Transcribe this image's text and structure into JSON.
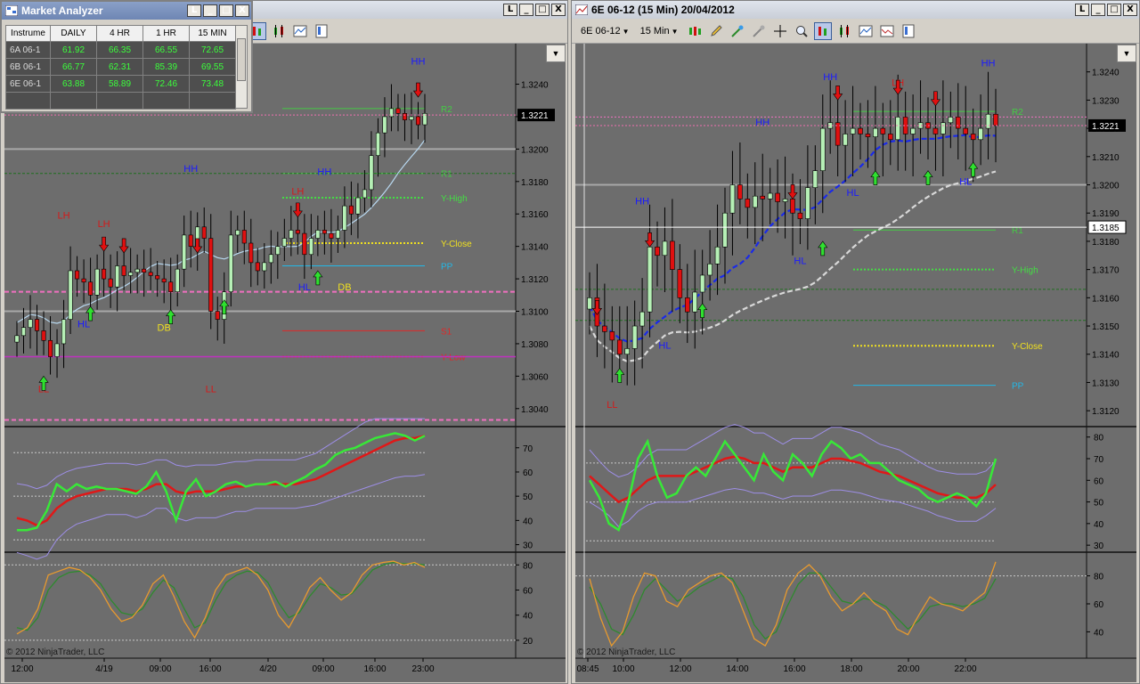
{
  "left_window": {
    "titlebar_buttons": [
      "L",
      "_",
      "□",
      "X"
    ]
  },
  "right_window": {
    "title": "6E 06-12 (15 Min)  20/04/2012",
    "titlebar_buttons": [
      "L",
      "_",
      "□",
      "X"
    ],
    "instrument": "6E 06-12",
    "interval": "15 Min"
  },
  "market_analyzer": {
    "title": "Market Analyzer",
    "columns": [
      "Instrume",
      "DAILY",
      "4 HR",
      "1 HR",
      "15 MIN"
    ],
    "rows": [
      [
        "6A 06-1",
        "61.92",
        "66.35",
        "66.55",
        "72.65"
      ],
      [
        "6B 06-1",
        "66.77",
        "62.31",
        "85.39",
        "69.55"
      ],
      [
        "6E 06-1",
        "63.88",
        "58.89",
        "72.46",
        "73.48"
      ]
    ]
  },
  "copyright": "© 2012 NinjaTrader, LLC",
  "colors": {
    "chart_bg": "#6d6d6d",
    "bull": "#b6f0b6",
    "bear": "#e01010",
    "rsi_green": "#38e838",
    "rsi_red": "#e01818",
    "stoch_orange": "#e89a2e",
    "stoch_green": "#2e8a2e",
    "band": "#9d8ee6",
    "blue_label": "#1a1aff",
    "red_label": "#d41a1a",
    "yellow_label": "#f0e020"
  },
  "chart_data": [
    {
      "id": "left",
      "type": "candlestick",
      "x_labels": [
        "12:00",
        "4/19",
        "09:00",
        "16:00",
        "4/20",
        "09:00",
        "16:00",
        "23:00"
      ],
      "price_ticks": [
        "1.3240",
        "1.3220",
        "1.3200",
        "1.3180",
        "1.3160",
        "1.3140",
        "1.3120",
        "1.3100",
        "1.3080",
        "1.3060",
        "1.3040"
      ],
      "ylim": [
        1.303,
        1.3265
      ],
      "current_price": "1.3221",
      "close": [
        1.3085,
        1.309,
        1.3095,
        1.3088,
        1.3082,
        1.3072,
        1.308,
        1.3095,
        1.3125,
        1.312,
        1.3118,
        1.311,
        1.3126,
        1.312,
        1.3115,
        1.3128,
        1.3122,
        1.3124,
        1.3126,
        1.3124,
        1.3122,
        1.312,
        1.3118,
        1.3112,
        1.3126,
        1.3147,
        1.314,
        1.3152,
        1.3145,
        1.31,
        1.3095,
        1.3112,
        1.3147,
        1.315,
        1.3142,
        1.313,
        1.3125,
        1.313,
        1.3135,
        1.314,
        1.3145,
        1.315,
        1.3148,
        1.3135,
        1.3145,
        1.315,
        1.3148,
        1.3145,
        1.315,
        1.3165,
        1.316,
        1.317,
        1.3175,
        1.3196,
        1.321,
        1.322,
        1.3225,
        1.3222,
        1.3218,
        1.322,
        1.3215,
        1.3222
      ],
      "levels": [
        {
          "label": "R2",
          "value": 1.3225,
          "color": "#44cc44"
        },
        {
          "label": "R1",
          "value": 1.3185,
          "color": "#44cc44"
        },
        {
          "label": "Y-High",
          "value": 1.317,
          "color": "#44dd44"
        },
        {
          "label": "Y-Close",
          "value": 1.3142,
          "color": "#f0e020"
        },
        {
          "label": "PP",
          "value": 1.3128,
          "color": "#22b8e8"
        },
        {
          "label": "S1",
          "value": 1.3088,
          "color": "#e02828"
        },
        {
          "label": "Y-Low",
          "value": 1.3072,
          "color": "#e02828"
        }
      ],
      "swing_labels": [
        {
          "text": "HH",
          "i": 60,
          "price": 1.3252,
          "color": "#1a1aff"
        },
        {
          "text": "HH",
          "i": 26,
          "price": 1.3186,
          "color": "#1a1aff"
        },
        {
          "text": "HH",
          "i": 46,
          "price": 1.3184,
          "color": "#1a1aff"
        },
        {
          "text": "LH",
          "i": 7,
          "price": 1.3157,
          "color": "#d41a1a"
        },
        {
          "text": "LH",
          "i": 13,
          "price": 1.3152,
          "color": "#d41a1a"
        },
        {
          "text": "LH",
          "i": 42,
          "price": 1.3172,
          "color": "#d41a1a"
        },
        {
          "text": "HL",
          "i": 10,
          "price": 1.309,
          "color": "#1a1aff"
        },
        {
          "text": "HL",
          "i": 43,
          "price": 1.3113,
          "color": "#1a1aff"
        },
        {
          "text": "DB",
          "i": 22,
          "price": 1.3088,
          "color": "#f0e020"
        },
        {
          "text": "DB",
          "i": 49,
          "price": 1.3113,
          "color": "#f0e020"
        },
        {
          "text": "LL",
          "i": 4,
          "price": 1.305,
          "color": "#d41a1a"
        },
        {
          "text": "LL",
          "i": 29,
          "price": 1.305,
          "color": "#d41a1a"
        }
      ],
      "rsi_ticks": [
        "70",
        "60",
        "50",
        "40",
        "30"
      ],
      "rsi_fast": [
        36,
        36,
        37,
        44,
        55,
        52,
        55,
        53,
        54,
        53,
        53,
        52,
        51,
        54,
        60,
        52,
        40,
        52,
        57,
        50,
        52,
        55,
        56,
        54,
        55,
        55,
        56,
        54,
        56,
        58,
        61,
        63,
        67,
        69,
        70,
        72,
        74,
        75,
        76,
        75,
        73,
        75
      ],
      "rsi_slow": [
        41,
        40,
        38,
        40,
        45,
        48,
        50,
        51,
        52,
        53,
        53,
        53,
        52,
        53,
        55,
        55,
        52,
        51,
        52,
        52,
        52,
        53,
        54,
        54,
        55,
        55,
        55,
        55,
        55,
        56,
        57,
        59,
        61,
        63,
        65,
        67,
        69,
        71,
        73,
        74,
        74,
        75
      ],
      "stoch_ticks": [
        "80",
        "60",
        "40",
        "20"
      ],
      "stoch_k": [
        25,
        30,
        45,
        72,
        75,
        78,
        76,
        70,
        60,
        45,
        35,
        38,
        48,
        65,
        72,
        55,
        35,
        22,
        38,
        60,
        72,
        75,
        78,
        72,
        60,
        40,
        30,
        45,
        62,
        70,
        60,
        52,
        58,
        72,
        80,
        82,
        83,
        80,
        82,
        78
      ],
      "stoch_d": [
        30,
        28,
        38,
        60,
        70,
        74,
        75,
        72,
        65,
        52,
        42,
        40,
        45,
        58,
        68,
        62,
        45,
        30,
        34,
        52,
        66,
        72,
        75,
        74,
        66,
        50,
        38,
        42,
        55,
        65,
        62,
        56,
        57,
        66,
        76,
        80,
        82,
        81,
        81,
        80
      ]
    },
    {
      "id": "right",
      "type": "candlestick",
      "x_labels": [
        "08:45",
        "10:00",
        "12:00",
        "14:00",
        "16:00",
        "18:00",
        "20:00",
        "22:00"
      ],
      "price_ticks": [
        "1.3240",
        "1.3230",
        "1.3220",
        "1.3210",
        "1.3200",
        "1.3190",
        "1.3180",
        "1.3170",
        "1.3160",
        "1.3150",
        "1.3140",
        "1.3130",
        "1.3120"
      ],
      "ylim": [
        1.3115,
        1.325
      ],
      "current_price": "1.3221",
      "crosshair_price": "1.3185",
      "close": [
        1.316,
        1.315,
        1.3148,
        1.3145,
        1.314,
        1.3142,
        1.315,
        1.3155,
        1.3178,
        1.3175,
        1.318,
        1.317,
        1.316,
        1.3155,
        1.3162,
        1.3168,
        1.3172,
        1.3178,
        1.319,
        1.32,
        1.3195,
        1.3192,
        1.3196,
        1.3195,
        1.3197,
        1.3194,
        1.3195,
        1.319,
        1.3188,
        1.3199,
        1.3205,
        1.322,
        1.3222,
        1.3214,
        1.3218,
        1.322,
        1.3218,
        1.3217,
        1.322,
        1.3218,
        1.3216,
        1.3224,
        1.3218,
        1.322,
        1.3222,
        1.322,
        1.3218,
        1.3222,
        1.3224,
        1.322,
        1.3218,
        1.3216,
        1.322,
        1.3225,
        1.3221
      ],
      "levels": [
        {
          "label": "R2",
          "value": 1.3226,
          "color": "#44cc44"
        },
        {
          "label": "R1",
          "value": 1.3184,
          "color": "#44cc44"
        },
        {
          "label": "Y-High",
          "value": 1.317,
          "color": "#44dd44"
        },
        {
          "label": "Y-Close",
          "value": 1.3143,
          "color": "#f0e020"
        },
        {
          "label": "PP",
          "value": 1.3129,
          "color": "#22b8e8"
        }
      ],
      "swing_labels": [
        {
          "text": "HH",
          "i": 53,
          "price": 1.3242,
          "color": "#1a1aff"
        },
        {
          "text": "HH",
          "i": 32,
          "price": 1.3237,
          "color": "#1a1aff"
        },
        {
          "text": "HH",
          "i": 23,
          "price": 1.3221,
          "color": "#1a1aff"
        },
        {
          "text": "HH",
          "i": 7,
          "price": 1.3193,
          "color": "#1a1aff"
        },
        {
          "text": "LH",
          "i": 41,
          "price": 1.3235,
          "color": "#d41a1a"
        },
        {
          "text": "HL",
          "i": 35,
          "price": 1.3196,
          "color": "#1a1aff"
        },
        {
          "text": "HL",
          "i": 50,
          "price": 1.32,
          "color": "#1a1aff"
        },
        {
          "text": "HL",
          "i": 28,
          "price": 1.3172,
          "color": "#1a1aff"
        },
        {
          "text": "HL",
          "i": 10,
          "price": 1.3142,
          "color": "#1a1aff"
        },
        {
          "text": "LL",
          "i": 3,
          "price": 1.3121,
          "color": "#d41a1a"
        }
      ],
      "rsi_ticks": [
        "80",
        "70",
        "60",
        "50",
        "40",
        "30"
      ],
      "rsi_fast": [
        60,
        52,
        40,
        37,
        50,
        70,
        78,
        62,
        52,
        54,
        62,
        66,
        62,
        70,
        78,
        72,
        66,
        60,
        72,
        64,
        60,
        72,
        68,
        62,
        72,
        78,
        75,
        70,
        72,
        68,
        68,
        64,
        60,
        58,
        56,
        52,
        50,
        52,
        54,
        52,
        48,
        54,
        70
      ],
      "rsi_slow": [
        62,
        58,
        54,
        50,
        52,
        56,
        60,
        62,
        62,
        62,
        62,
        64,
        66,
        68,
        70,
        71,
        70,
        68,
        68,
        66,
        64,
        66,
        66,
        66,
        68,
        70,
        70,
        69,
        68,
        66,
        64,
        63,
        62,
        60,
        58,
        56,
        54,
        53,
        52,
        52,
        52,
        54,
        58
      ],
      "stoch_ticks": [
        "80",
        "60",
        "40"
      ],
      "stoch_k": [
        78,
        50,
        30,
        40,
        65,
        82,
        80,
        62,
        58,
        70,
        75,
        80,
        82,
        75,
        55,
        35,
        30,
        45,
        70,
        82,
        88,
        80,
        65,
        55,
        60,
        68,
        60,
        55,
        42,
        38,
        52,
        65,
        60,
        58,
        55,
        62,
        68,
        90
      ],
      "stoch_d": [
        72,
        60,
        42,
        38,
        52,
        70,
        78,
        70,
        62,
        66,
        72,
        76,
        80,
        78,
        65,
        45,
        35,
        40,
        58,
        74,
        82,
        82,
        72,
        62,
        60,
        64,
        62,
        58,
        50,
        42,
        48,
        58,
        60,
        60,
        58,
        60,
        64,
        78
      ]
    }
  ]
}
